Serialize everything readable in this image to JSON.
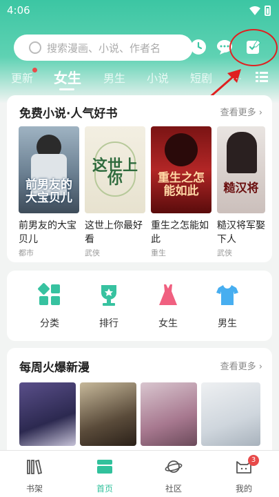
{
  "status_bar": {
    "time": "4:06"
  },
  "search": {
    "placeholder": "搜索漫画、小说、作者名"
  },
  "header_icons": [
    "clock-icon",
    "chat-bubble-icon",
    "check-in-icon"
  ],
  "tabs": [
    {
      "label": "更新",
      "has_dot": true
    },
    {
      "label": "女生",
      "active": true
    },
    {
      "label": "男生"
    },
    {
      "label": "小说"
    },
    {
      "label": "短剧"
    },
    {
      "label": "..."
    }
  ],
  "free_novels": {
    "title": "免费小说·人气好书",
    "more": "查看更多",
    "books": [
      {
        "title": "前男友的大宝贝儿",
        "tag": "都市",
        "cover_text": "前男友的大宝贝儿"
      },
      {
        "title": "这世上你最好看",
        "tag": "武侠",
        "cover_text": "这世上你"
      },
      {
        "title": "重生之怎能如此",
        "tag": "重生",
        "cover_text": "重生之怎能如此"
      },
      {
        "title": "糙汉将军娶下人",
        "tag": "武侠",
        "cover_text": "糙汉将"
      }
    ]
  },
  "categories": [
    {
      "label": "分类",
      "icon": "grid-icon"
    },
    {
      "label": "排行",
      "icon": "trophy-icon"
    },
    {
      "label": "女生",
      "icon": "dress-icon"
    },
    {
      "label": "男生",
      "icon": "tshirt-icon"
    }
  ],
  "weekly_comics": {
    "title": "每周火爆新漫",
    "more": "查看更多"
  },
  "bottom_nav": [
    {
      "label": "书架",
      "icon": "bookshelf-icon"
    },
    {
      "label": "首页",
      "icon": "home-icon",
      "active": true
    },
    {
      "label": "社区",
      "icon": "planet-icon"
    },
    {
      "label": "我的",
      "icon": "cat-profile-icon",
      "badge": "3"
    }
  ],
  "colors": {
    "accent": "#31c19c",
    "annotation": "#e02020",
    "badge": "#e84a4a"
  }
}
